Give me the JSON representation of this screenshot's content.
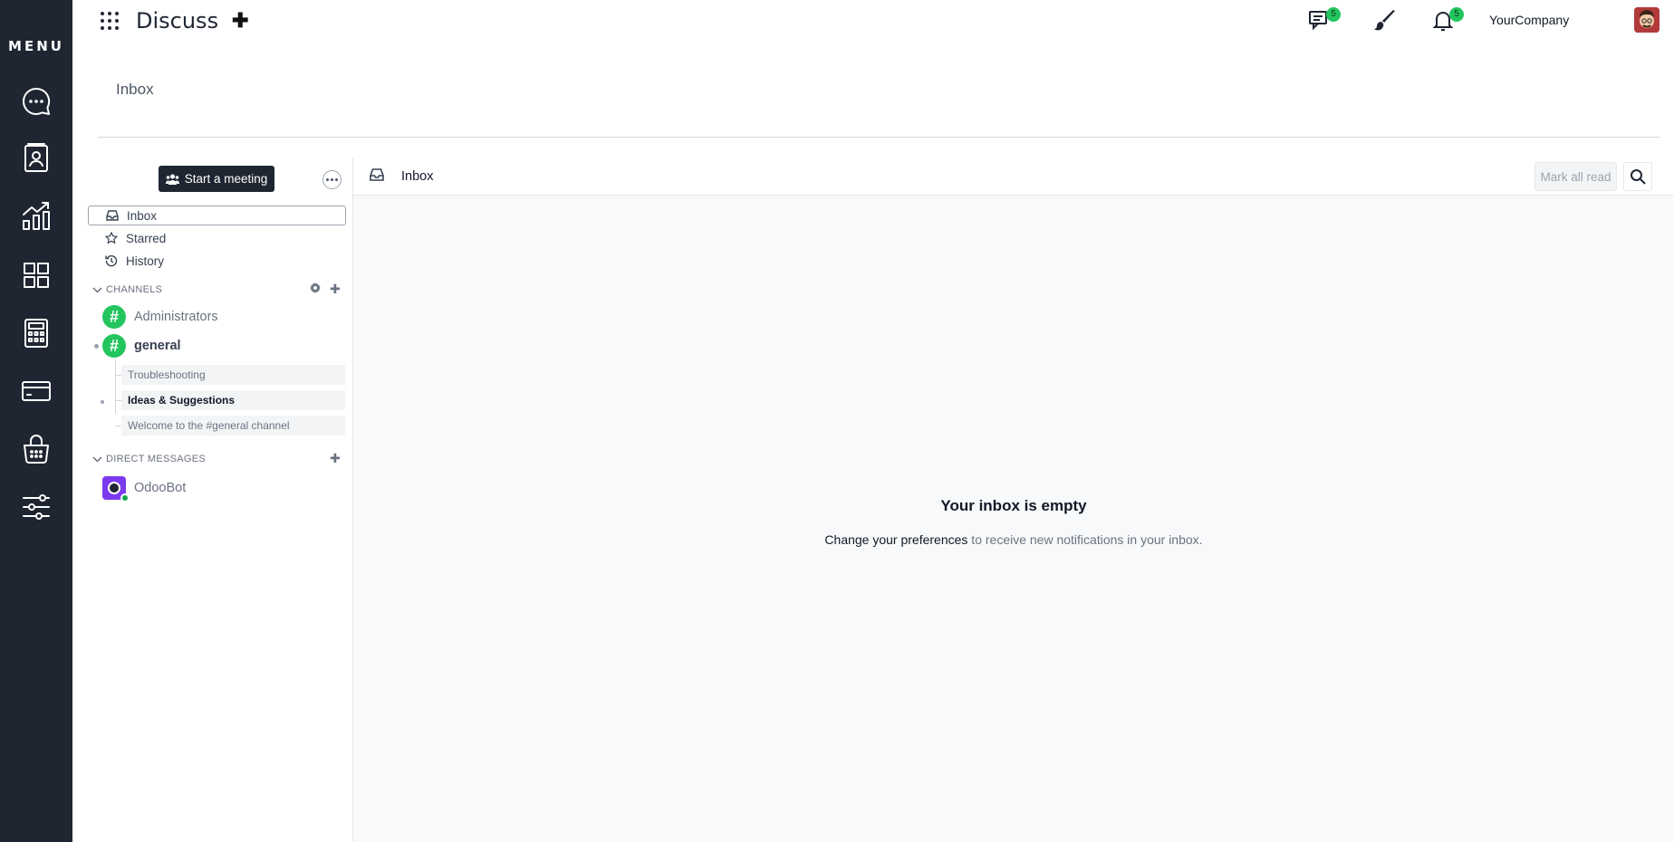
{
  "rail": {
    "menu_label": "MENU",
    "apps": [
      "discuss-icon",
      "contacts-icon",
      "analytics-icon",
      "apps-grid-icon",
      "calculator-icon",
      "card-icon",
      "basket-icon",
      "settings-sliders-icon"
    ]
  },
  "topbar": {
    "app_title": "Discuss",
    "messages_badge": "5",
    "activities_badge": "5",
    "company": "YourCompany"
  },
  "breadcrumb": "Inbox",
  "sidebar": {
    "start_meeting": "Start a meeting",
    "mailboxes": [
      {
        "label": "Inbox",
        "icon": "inbox-icon"
      },
      {
        "label": "Starred",
        "icon": "star-icon"
      },
      {
        "label": "History",
        "icon": "history-icon"
      }
    ],
    "channels_header": "CHANNELS",
    "channels": [
      {
        "name": "Administrators"
      },
      {
        "name": "general"
      }
    ],
    "threads": [
      {
        "name": "Troubleshooting"
      },
      {
        "name": "Ideas & Suggestions"
      },
      {
        "name": "Welcome to the #general channel"
      }
    ],
    "dm_header": "DIRECT MESSAGES",
    "direct_messages": [
      {
        "name": "OdooBot"
      }
    ]
  },
  "main": {
    "header_title": "Inbox",
    "mark_all_read": "Mark all read",
    "empty_title": "Your inbox is empty",
    "empty_link": "Change your preferences",
    "empty_rest": " to receive new notifications in your inbox."
  },
  "colors": {
    "rail_bg": "#1f2632",
    "channel_green": "#22c55e",
    "badge_green": "#22c55e"
  }
}
